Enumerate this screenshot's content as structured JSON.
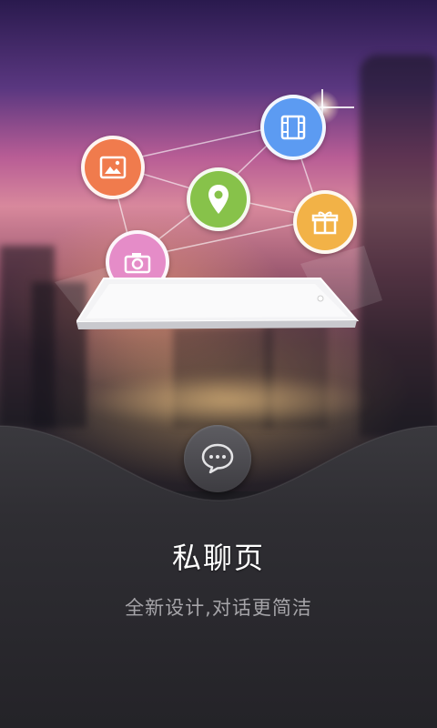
{
  "feature": {
    "title": "私聊页",
    "subtitle": "全新设计,对话更简洁"
  },
  "illustration": {
    "nodes": [
      {
        "name": "image-icon",
        "color": "#f07b4d"
      },
      {
        "name": "video-icon",
        "color": "#5c9bf2"
      },
      {
        "name": "location-pin-icon",
        "color": "#87c24a"
      },
      {
        "name": "gift-icon",
        "color": "#f2b247"
      },
      {
        "name": "camera-icon",
        "color": "#e58cc8"
      }
    ],
    "device": "tablet"
  },
  "chat_button": {
    "icon": "chat-bubble-icon"
  },
  "colors": {
    "panel_background": "#2b2a2f",
    "title_text": "#ffffff",
    "subtitle_text": "#a6a5a9"
  }
}
